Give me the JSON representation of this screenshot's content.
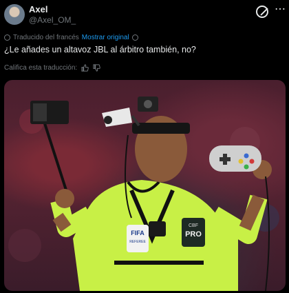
{
  "author": {
    "name": "Axel",
    "handle": "@Axel_OM_"
  },
  "translation": {
    "note": "Traducido del francés",
    "show_original": "Mostrar original"
  },
  "tweet": {
    "text": "¿Le añades un altavoz JBL al árbitro también, no?"
  },
  "rating": {
    "label": "Califica esta traducción:"
  },
  "photo": {
    "badge_left": "FIFA",
    "badge_left_sub": "REFEREE",
    "badge_right": "CBF",
    "badge_right_sub": "PRO"
  },
  "icons": [
    "avatar",
    "grok-icon",
    "more-icon",
    "translate-icon",
    "info-icon",
    "thumbs-up-icon",
    "thumbs-down-icon"
  ]
}
